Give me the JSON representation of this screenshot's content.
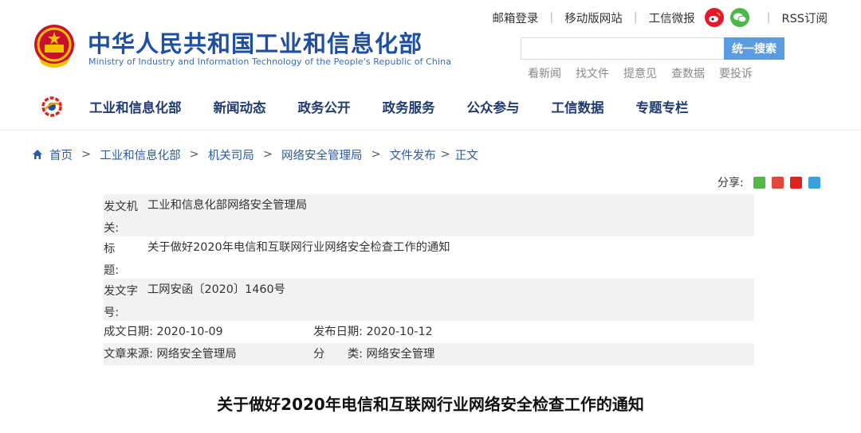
{
  "header": {
    "title": "中华人民共和国工业和信息化部",
    "subtitle": "Ministry of Industry and Information Technology of the People's Republic of China",
    "top_links": [
      "邮箱登录",
      "移动版网站",
      "工信微报"
    ],
    "rss_label": "RSS订阅",
    "search": {
      "value": "",
      "button_label": "统一搜索"
    },
    "quick_links": [
      "看新闻",
      "找文件",
      "提意见",
      "查数据",
      "要投诉"
    ],
    "nav": [
      "工业和信息化部",
      "新闻动态",
      "政务公开",
      "政务服务",
      "公众参与",
      "工信数据",
      "专题专栏"
    ]
  },
  "breadcrumb": [
    "首页",
    "工业和信息化部",
    "机关司局",
    "网络安全管理局",
    "文件发布",
    "正文"
  ],
  "share": {
    "label": "分享:"
  },
  "meta": {
    "issuer_label": "发文机关:",
    "issuer_value": "工业和信息化部网络安全管理局",
    "title_label": "标　　题:",
    "title_value": "关于做好2020年电信和互联网行业网络安全检查工作的通知",
    "docno_label": "发文字号:",
    "docno_value": "工网安函〔2020〕1460号",
    "written_date": "成文日期:  2020-10-09",
    "publish_date": "发布日期:  2020-10-12",
    "source": "文章来源:  网络安全管理局",
    "category": "分　　类:  网络安全管理"
  },
  "document_title": "关于做好2020年电信和互联网行业网络安全检查工作的通知",
  "colors": {
    "brand_blue": "#1f4fa0",
    "search_button": "#5b9be0",
    "meta_stripe": "#f2f2f2"
  }
}
